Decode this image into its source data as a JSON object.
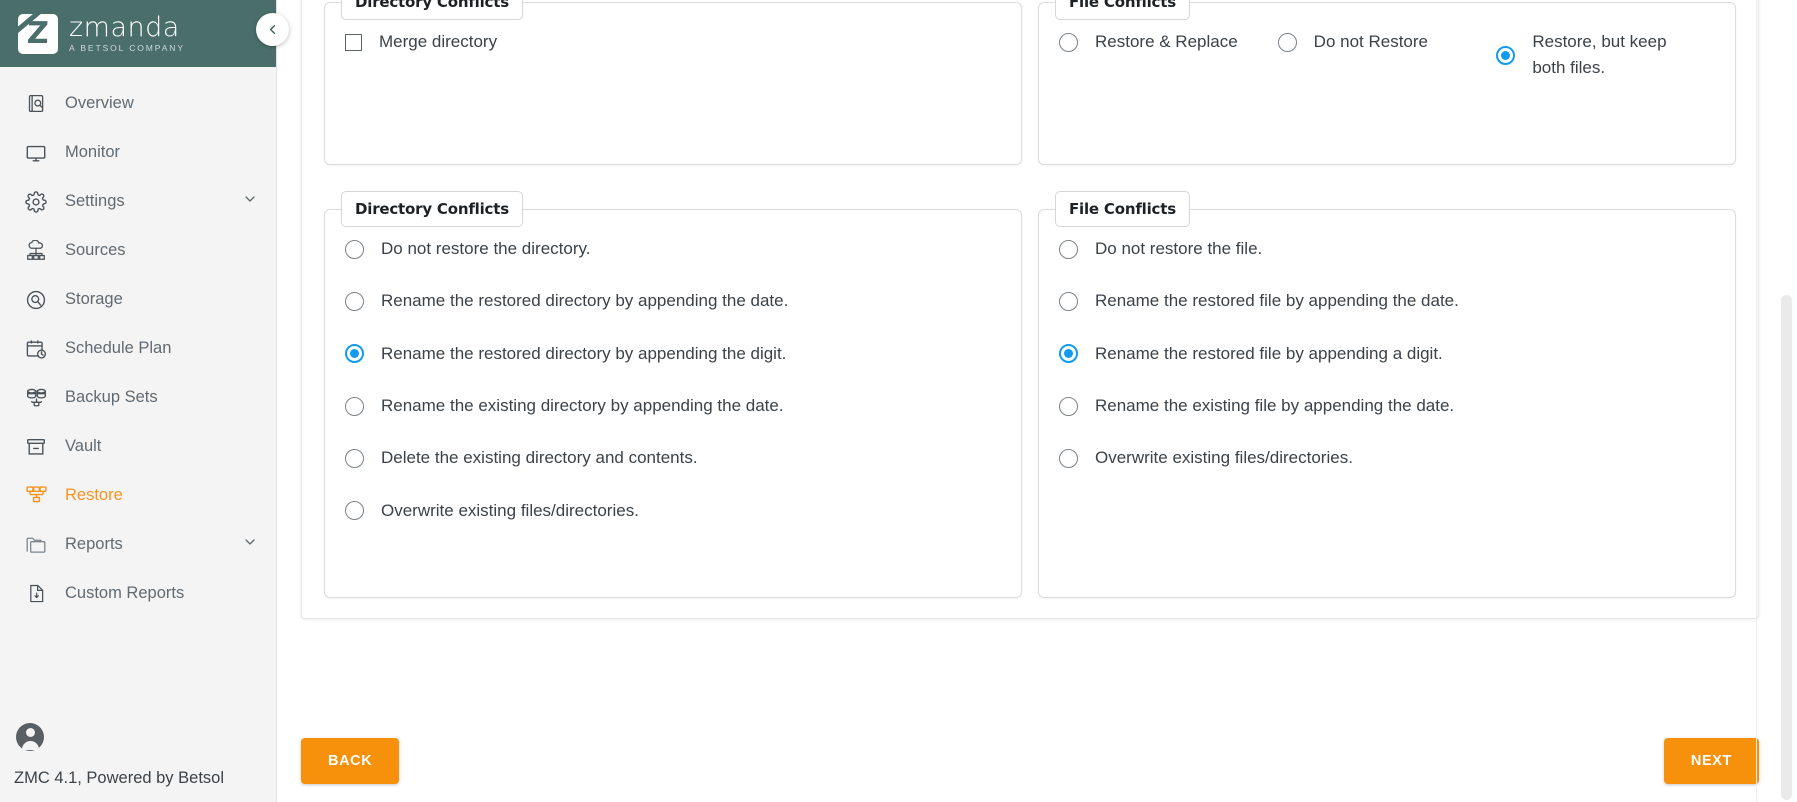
{
  "brand": {
    "name": "zmanda",
    "tagline": "A BETSOL COMPANY",
    "logo_letter": "Z"
  },
  "sidebar": {
    "items": [
      {
        "label": "Overview",
        "icon": "overview-icon",
        "active": false,
        "chevron": false
      },
      {
        "label": "Monitor",
        "icon": "monitor-icon",
        "active": false,
        "chevron": false
      },
      {
        "label": "Settings",
        "icon": "gear-icon",
        "active": false,
        "chevron": true
      },
      {
        "label": "Sources",
        "icon": "sources-icon",
        "active": false,
        "chevron": false
      },
      {
        "label": "Storage",
        "icon": "storage-icon",
        "active": false,
        "chevron": false
      },
      {
        "label": "Schedule Plan",
        "icon": "calendar-clock-icon",
        "active": false,
        "chevron": false
      },
      {
        "label": "Backup Sets",
        "icon": "database-icon",
        "active": false,
        "chevron": false
      },
      {
        "label": "Vault",
        "icon": "vault-icon",
        "active": false,
        "chevron": false
      },
      {
        "label": "Restore",
        "icon": "restore-icon",
        "active": true,
        "chevron": false
      },
      {
        "label": "Reports",
        "icon": "reports-icon",
        "active": false,
        "chevron": true
      },
      {
        "label": "Custom Reports",
        "icon": "document-icon",
        "active": false,
        "chevron": false
      }
    ],
    "version": "ZMC 4.1, Powered by Betsol",
    "collapse_icon": "chevron-left-icon",
    "avatar_icon": "user-avatar-icon",
    "active_color": "#f79421",
    "brand_bg": "#4a6f6b"
  },
  "panels": {
    "directory_top": {
      "legend": "Directory Conflicts",
      "checkbox": {
        "label": "Merge directory",
        "checked": false
      }
    },
    "file_top": {
      "legend": "File Conflicts",
      "options": [
        {
          "label": "Restore & Replace",
          "checked": false
        },
        {
          "label": "Do not Restore",
          "checked": false
        },
        {
          "label": "Restore, but keep both files.",
          "checked": true
        }
      ]
    },
    "directory_bottom": {
      "legend": "Directory Conflicts",
      "options": [
        {
          "label": "Do not restore the directory.",
          "checked": false
        },
        {
          "label": "Rename the restored directory by appending the date.",
          "checked": false
        },
        {
          "label": "Rename the restored directory by appending the digit.",
          "checked": true
        },
        {
          "label": "Rename the existing directory by appending the date.",
          "checked": false
        },
        {
          "label": "Delete the existing directory and contents.",
          "checked": false
        },
        {
          "label": "Overwrite existing files/directories.",
          "checked": false
        }
      ]
    },
    "file_bottom": {
      "legend": "File Conflicts",
      "options": [
        {
          "label": "Do not restore the file.",
          "checked": false
        },
        {
          "label": "Rename the restored file by appending the date.",
          "checked": false
        },
        {
          "label": "Rename the restored file by appending a digit.",
          "checked": true
        },
        {
          "label": "Rename the existing file by appending the date.",
          "checked": false
        },
        {
          "label": "Overwrite existing files/directories.",
          "checked": false
        }
      ]
    }
  },
  "footer": {
    "back_label": "BACK",
    "next_label": "NEXT",
    "button_color": "#f7900a"
  }
}
